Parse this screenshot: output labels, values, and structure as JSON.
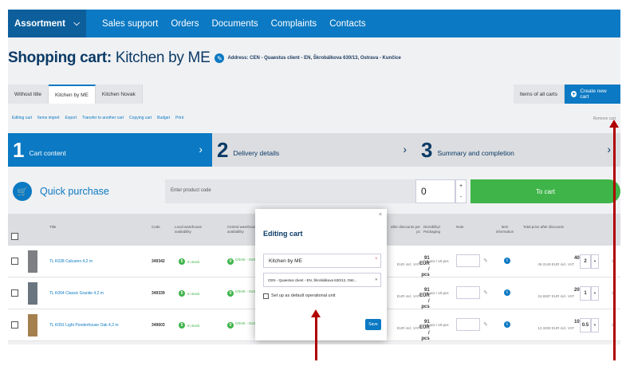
{
  "nav": {
    "assortment": "Assortment",
    "links": [
      "Sales support",
      "Orders",
      "Documents",
      "Complaints",
      "Contacts"
    ]
  },
  "page": {
    "title_prefix": "Shopping cart:",
    "title_name": "Kitchen by ME",
    "address": "Address: CEN - Quaestus client - EN, Škrobálkova 630/13, Ostrava - Kunčice"
  },
  "tabs": [
    "Without title",
    "Kitchen by ME",
    "Kitchen Novak"
  ],
  "tabs_right": {
    "all": "Items of all carts",
    "new": "Create new cart"
  },
  "actions": [
    "Editing cart",
    "Items import",
    "Export",
    "Transfer to another cart",
    "Copying cart",
    "Budget",
    "Print"
  ],
  "remove_cart": "Remove cart",
  "steps": [
    {
      "num": "1",
      "label": "Cart content"
    },
    {
      "num": "2",
      "label": "Delivery details"
    },
    {
      "num": "3",
      "label": "Summary and completion"
    }
  ],
  "quick": {
    "label": "Quick purchase",
    "placeholder": "Enter product code",
    "qty": "0",
    "to_cart": "To cart"
  },
  "table": {
    "headers": [
      "Title",
      "Code",
      "Local warehouse availability",
      "Central warehouse availability",
      "after discounts per pc",
      "Divisibility/ Packaging",
      "Note",
      "Item information",
      "Total price after discounts"
    ],
    "rows": [
      {
        "title": "TL K038 Calcareo 4,2 m",
        "code": "349342",
        "local": "In stock",
        "central": "OSHK - Ostr... On request",
        "price": "91 EUR / pcs",
        "price_sub": "EUR incl. VAT",
        "pack": "0.5 pcs / 10 pcs",
        "total": "40.7561 EUR",
        "total_sub": "49.3149 EUR incl. VAT",
        "qty": "2"
      },
      {
        "title": "TL K064 Classic Granite 4,2 m",
        "code": "349339",
        "local": "In stock",
        "central": "OSHK - Ostr... On request",
        "price": "91 EUR / pcs",
        "price_sub": "EUR incl. VAT",
        "pack": "0.5 pcs / 10 pcs",
        "total": "20.3791 EUR",
        "total_sub": "24.6587 EUR incl. VAT",
        "qty": "1"
      },
      {
        "title": "TL K091 Light Ponderhouse Oak 4,2 m",
        "code": "349603",
        "local": "In stock",
        "central": "OSHK - Ostr... On request",
        "price": "91 EUR / pcs",
        "price_sub": "EUR incl. VAT",
        "pack": "0.5 pcs / 10 pcs",
        "total": "10.1895 EUR",
        "total_sub": "12.3293 EUR incl. VAT",
        "qty": "0.5"
      }
    ]
  },
  "modal": {
    "title": "Editing cart",
    "name_value": "Kitchen by ME",
    "unit_value": "CEN - Quaestus client - EN, Škrobálkova 630/13, Ostr...",
    "checkbox_label": "Set up as default operational unit",
    "save": "Save",
    "close": "×"
  },
  "colors": {
    "primary": "#0b79c3",
    "green": "#3eb449",
    "annotation": "#b00000"
  }
}
